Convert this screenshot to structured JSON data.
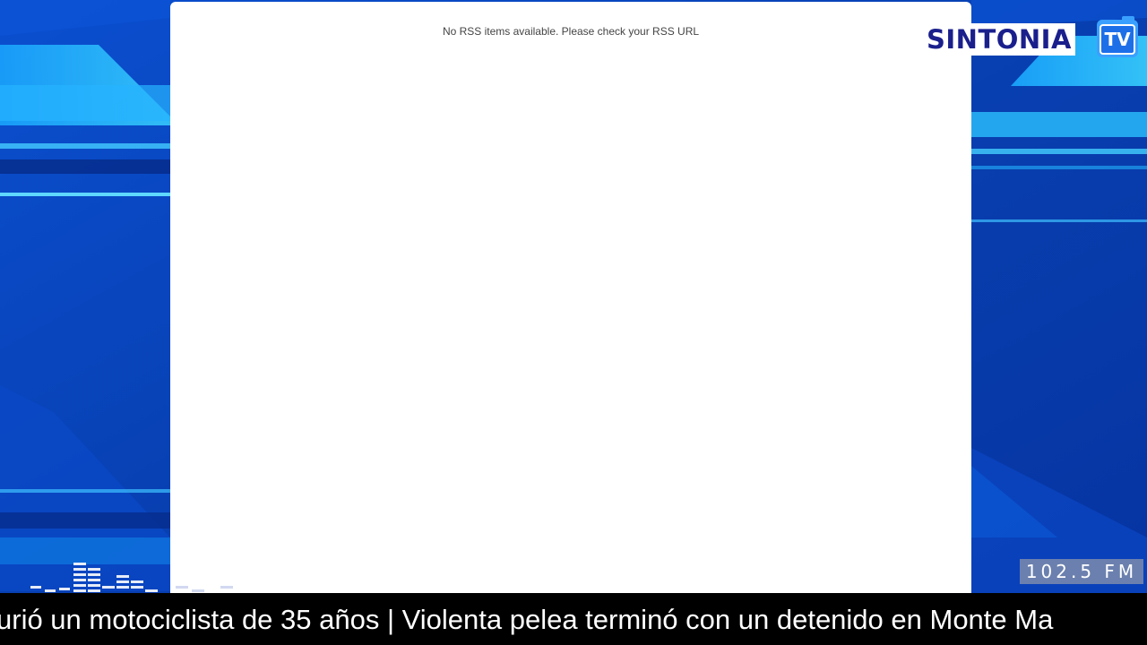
{
  "rss": {
    "message": "No RSS items available. Please check your RSS URL"
  },
  "logo": {
    "name": "SINTONIA",
    "tv": "TV"
  },
  "station": {
    "frequency": "102.5 FM"
  },
  "ticker": {
    "text": "urió un motociclista de 35 años | Violenta pelea terminó con un detenido en Monte Ma"
  },
  "colors": {
    "background_blue": "#0a3fb0",
    "highlight_cyan": "#2ec5ff",
    "logo_navy": "#1a1f8c",
    "ticker_bg": "#000000"
  }
}
